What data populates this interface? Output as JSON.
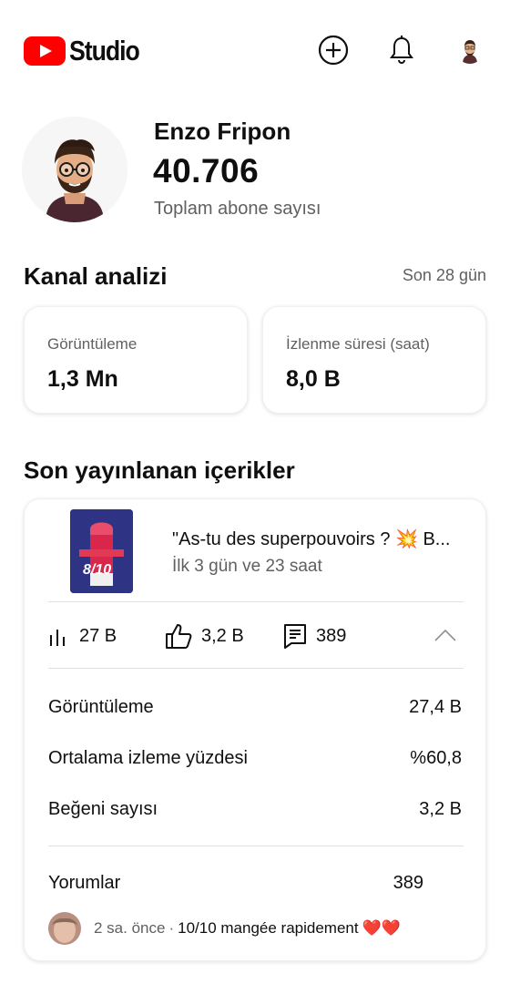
{
  "header": {
    "logo_text": "Studio",
    "icons": [
      "create-icon",
      "notifications-bell-icon",
      "account-avatar"
    ]
  },
  "channel": {
    "name": "Enzo Fripon",
    "subscriber_count": "40.706",
    "subscriber_label": "Toplam abone sayısı"
  },
  "analytics": {
    "title": "Kanal analizi",
    "period": "Son 28 gün",
    "cards": [
      {
        "label": "Görüntüleme",
        "value": "1,3 Mn"
      },
      {
        "label": "İzlenme süresi (saat)",
        "value": "8,0 B"
      }
    ]
  },
  "recent": {
    "title": "Son yayınlanan içerikler",
    "video": {
      "title": "\"As-tu des superpouvoirs ? 💥 B...",
      "age": "İlk 3 gün ve 23 saat",
      "thumb_score": "8/10"
    },
    "stats": {
      "views": "27 B",
      "likes": "3,2 B",
      "comments": "389"
    },
    "details": [
      {
        "label": "Görüntüleme",
        "value": "27,4 B"
      },
      {
        "label": "Ortalama izleme yüzdesi",
        "value": "%60,8"
      },
      {
        "label": "Beğeni sayısı",
        "value": "3,2 B"
      }
    ],
    "comments_label": "Yorumlar",
    "comments_count": "389",
    "latest_comment": {
      "time": "2 sa. önce",
      "separator": "·",
      "text": "10/10 mangée rapidement",
      "emoji": "❤️❤️"
    }
  },
  "colors": {
    "brand_red": "#ff0000",
    "text": "#0f0f0f",
    "secondary": "#606060",
    "divider": "#e0e0e0"
  }
}
